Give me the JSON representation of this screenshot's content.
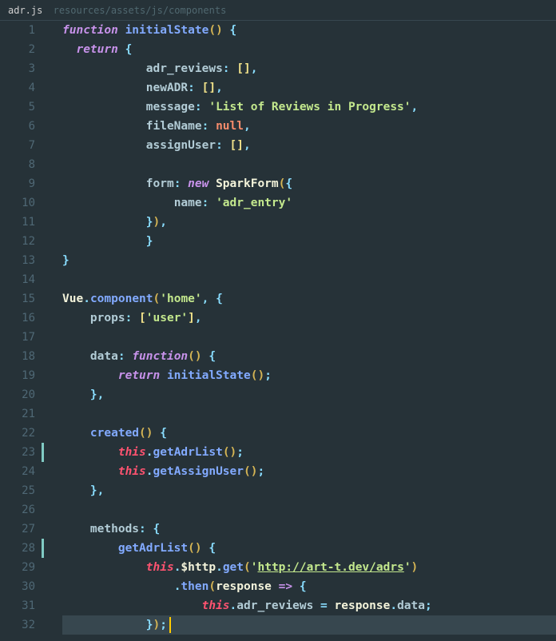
{
  "header": {
    "filename": "adr.js",
    "filepath": "resources/assets/js/components"
  },
  "lines": [
    {
      "num": 1,
      "marker": false,
      "hl": false,
      "tokens": [
        {
          "c": "kw",
          "t": "function "
        },
        {
          "c": "fn",
          "t": "initialState"
        },
        {
          "c": "paren",
          "t": "()"
        },
        {
          "c": "",
          "t": " "
        },
        {
          "c": "punct",
          "t": "{"
        }
      ]
    },
    {
      "num": 2,
      "marker": false,
      "hl": false,
      "tokens": [
        {
          "c": "",
          "t": "  "
        },
        {
          "c": "kw",
          "t": "return "
        },
        {
          "c": "punct",
          "t": "{"
        }
      ]
    },
    {
      "num": 3,
      "marker": false,
      "hl": false,
      "tokens": [
        {
          "c": "",
          "t": "            "
        },
        {
          "c": "prop",
          "t": "adr_reviews"
        },
        {
          "c": "punct",
          "t": ":"
        },
        {
          "c": "",
          "t": " "
        },
        {
          "c": "brack",
          "t": "[]"
        },
        {
          "c": "punct",
          "t": ","
        }
      ]
    },
    {
      "num": 4,
      "marker": false,
      "hl": false,
      "tokens": [
        {
          "c": "",
          "t": "            "
        },
        {
          "c": "prop",
          "t": "newADR"
        },
        {
          "c": "punct",
          "t": ":"
        },
        {
          "c": "",
          "t": " "
        },
        {
          "c": "brack",
          "t": "[]"
        },
        {
          "c": "punct",
          "t": ","
        }
      ]
    },
    {
      "num": 5,
      "marker": false,
      "hl": false,
      "tokens": [
        {
          "c": "",
          "t": "            "
        },
        {
          "c": "prop",
          "t": "message"
        },
        {
          "c": "punct",
          "t": ":"
        },
        {
          "c": "",
          "t": " "
        },
        {
          "c": "str",
          "t": "'List of Reviews in Progress'"
        },
        {
          "c": "punct",
          "t": ","
        }
      ]
    },
    {
      "num": 6,
      "marker": false,
      "hl": false,
      "tokens": [
        {
          "c": "",
          "t": "            "
        },
        {
          "c": "prop",
          "t": "fileName"
        },
        {
          "c": "punct",
          "t": ":"
        },
        {
          "c": "",
          "t": " "
        },
        {
          "c": "num-null",
          "t": "null"
        },
        {
          "c": "punct",
          "t": ","
        }
      ]
    },
    {
      "num": 7,
      "marker": false,
      "hl": false,
      "tokens": [
        {
          "c": "",
          "t": "            "
        },
        {
          "c": "prop",
          "t": "assignUser"
        },
        {
          "c": "punct",
          "t": ":"
        },
        {
          "c": "",
          "t": " "
        },
        {
          "c": "brack",
          "t": "[]"
        },
        {
          "c": "punct",
          "t": ","
        }
      ]
    },
    {
      "num": 8,
      "marker": false,
      "hl": false,
      "tokens": []
    },
    {
      "num": 9,
      "marker": false,
      "hl": false,
      "tokens": [
        {
          "c": "",
          "t": "            "
        },
        {
          "c": "prop",
          "t": "form"
        },
        {
          "c": "punct",
          "t": ":"
        },
        {
          "c": "",
          "t": " "
        },
        {
          "c": "kw",
          "t": "new "
        },
        {
          "c": "ident",
          "t": "SparkForm"
        },
        {
          "c": "paren",
          "t": "("
        },
        {
          "c": "punct",
          "t": "{"
        }
      ]
    },
    {
      "num": 10,
      "marker": false,
      "hl": false,
      "tokens": [
        {
          "c": "",
          "t": "                "
        },
        {
          "c": "prop",
          "t": "name"
        },
        {
          "c": "punct",
          "t": ":"
        },
        {
          "c": "",
          "t": " "
        },
        {
          "c": "str",
          "t": "'adr_entry'"
        }
      ]
    },
    {
      "num": 11,
      "marker": false,
      "hl": false,
      "tokens": [
        {
          "c": "",
          "t": "            "
        },
        {
          "c": "punct",
          "t": "}"
        },
        {
          "c": "paren",
          "t": ")"
        },
        {
          "c": "punct",
          "t": ","
        }
      ]
    },
    {
      "num": 12,
      "marker": false,
      "hl": false,
      "tokens": [
        {
          "c": "",
          "t": "            "
        },
        {
          "c": "punct",
          "t": "}"
        }
      ]
    },
    {
      "num": 13,
      "marker": false,
      "hl": false,
      "tokens": [
        {
          "c": "punct",
          "t": "}"
        }
      ]
    },
    {
      "num": 14,
      "marker": false,
      "hl": false,
      "tokens": []
    },
    {
      "num": 15,
      "marker": false,
      "hl": false,
      "tokens": [
        {
          "c": "ident",
          "t": "Vue"
        },
        {
          "c": "punct",
          "t": "."
        },
        {
          "c": "method",
          "t": "component"
        },
        {
          "c": "paren",
          "t": "("
        },
        {
          "c": "str",
          "t": "'home'"
        },
        {
          "c": "punct",
          "t": ","
        },
        {
          "c": "",
          "t": " "
        },
        {
          "c": "punct",
          "t": "{"
        }
      ]
    },
    {
      "num": 16,
      "marker": false,
      "hl": false,
      "tokens": [
        {
          "c": "",
          "t": "    "
        },
        {
          "c": "prop",
          "t": "props"
        },
        {
          "c": "punct",
          "t": ":"
        },
        {
          "c": "",
          "t": " "
        },
        {
          "c": "brack",
          "t": "["
        },
        {
          "c": "str",
          "t": "'user'"
        },
        {
          "c": "brack",
          "t": "]"
        },
        {
          "c": "punct",
          "t": ","
        }
      ]
    },
    {
      "num": 17,
      "marker": false,
      "hl": false,
      "tokens": []
    },
    {
      "num": 18,
      "marker": false,
      "hl": false,
      "tokens": [
        {
          "c": "",
          "t": "    "
        },
        {
          "c": "prop",
          "t": "data"
        },
        {
          "c": "punct",
          "t": ":"
        },
        {
          "c": "",
          "t": " "
        },
        {
          "c": "kw",
          "t": "function"
        },
        {
          "c": "paren",
          "t": "()"
        },
        {
          "c": "",
          "t": " "
        },
        {
          "c": "punct",
          "t": "{"
        }
      ]
    },
    {
      "num": 19,
      "marker": false,
      "hl": false,
      "tokens": [
        {
          "c": "",
          "t": "        "
        },
        {
          "c": "kw",
          "t": "return "
        },
        {
          "c": "method",
          "t": "initialState"
        },
        {
          "c": "paren",
          "t": "()"
        },
        {
          "c": "punct",
          "t": ";"
        }
      ]
    },
    {
      "num": 20,
      "marker": false,
      "hl": false,
      "tokens": [
        {
          "c": "",
          "t": "    "
        },
        {
          "c": "punct",
          "t": "},"
        }
      ]
    },
    {
      "num": 21,
      "marker": false,
      "hl": false,
      "tokens": []
    },
    {
      "num": 22,
      "marker": false,
      "hl": false,
      "tokens": [
        {
          "c": "",
          "t": "    "
        },
        {
          "c": "method",
          "t": "created"
        },
        {
          "c": "paren",
          "t": "()"
        },
        {
          "c": "",
          "t": " "
        },
        {
          "c": "punct",
          "t": "{"
        }
      ]
    },
    {
      "num": 23,
      "marker": true,
      "hl": false,
      "tokens": [
        {
          "c": "",
          "t": "        "
        },
        {
          "c": "this",
          "t": "this"
        },
        {
          "c": "punct",
          "t": "."
        },
        {
          "c": "method",
          "t": "getAdrList"
        },
        {
          "c": "paren",
          "t": "()"
        },
        {
          "c": "punct",
          "t": ";"
        }
      ]
    },
    {
      "num": 24,
      "marker": false,
      "hl": false,
      "tokens": [
        {
          "c": "",
          "t": "        "
        },
        {
          "c": "this",
          "t": "this"
        },
        {
          "c": "punct",
          "t": "."
        },
        {
          "c": "method",
          "t": "getAssignUser"
        },
        {
          "c": "paren",
          "t": "()"
        },
        {
          "c": "punct",
          "t": ";"
        }
      ]
    },
    {
      "num": 25,
      "marker": false,
      "hl": false,
      "tokens": [
        {
          "c": "",
          "t": "    "
        },
        {
          "c": "punct",
          "t": "},"
        }
      ]
    },
    {
      "num": 26,
      "marker": false,
      "hl": false,
      "tokens": []
    },
    {
      "num": 27,
      "marker": false,
      "hl": false,
      "tokens": [
        {
          "c": "",
          "t": "    "
        },
        {
          "c": "prop",
          "t": "methods"
        },
        {
          "c": "punct",
          "t": ":"
        },
        {
          "c": "",
          "t": " "
        },
        {
          "c": "punct",
          "t": "{"
        }
      ]
    },
    {
      "num": 28,
      "marker": true,
      "hl": false,
      "tokens": [
        {
          "c": "",
          "t": "        "
        },
        {
          "c": "method",
          "t": "getAdrList"
        },
        {
          "c": "paren",
          "t": "()"
        },
        {
          "c": "",
          "t": " "
        },
        {
          "c": "punct",
          "t": "{"
        }
      ]
    },
    {
      "num": 29,
      "marker": false,
      "hl": false,
      "tokens": [
        {
          "c": "",
          "t": "            "
        },
        {
          "c": "this",
          "t": "this"
        },
        {
          "c": "punct",
          "t": "."
        },
        {
          "c": "ident",
          "t": "$http"
        },
        {
          "c": "punct",
          "t": "."
        },
        {
          "c": "method",
          "t": "get"
        },
        {
          "c": "paren",
          "t": "("
        },
        {
          "c": "str",
          "t": "'"
        },
        {
          "c": "link",
          "t": "http://art-t.dev/adrs"
        },
        {
          "c": "str",
          "t": "'"
        },
        {
          "c": "paren",
          "t": ")"
        }
      ]
    },
    {
      "num": 30,
      "marker": false,
      "hl": false,
      "tokens": [
        {
          "c": "",
          "t": "                "
        },
        {
          "c": "punct",
          "t": "."
        },
        {
          "c": "method",
          "t": "then"
        },
        {
          "c": "paren",
          "t": "("
        },
        {
          "c": "ident",
          "t": "response"
        },
        {
          "c": "",
          "t": " "
        },
        {
          "c": "kw",
          "t": "=>"
        },
        {
          "c": "",
          "t": " "
        },
        {
          "c": "punct",
          "t": "{"
        }
      ]
    },
    {
      "num": 31,
      "marker": false,
      "hl": false,
      "tokens": [
        {
          "c": "",
          "t": "                    "
        },
        {
          "c": "this",
          "t": "this"
        },
        {
          "c": "punct",
          "t": "."
        },
        {
          "c": "prop",
          "t": "adr_reviews"
        },
        {
          "c": "",
          "t": " "
        },
        {
          "c": "punct",
          "t": "="
        },
        {
          "c": "",
          "t": " "
        },
        {
          "c": "ident",
          "t": "response"
        },
        {
          "c": "punct",
          "t": "."
        },
        {
          "c": "prop",
          "t": "data"
        },
        {
          "c": "punct",
          "t": ";"
        }
      ]
    },
    {
      "num": 32,
      "marker": false,
      "hl": true,
      "cursor": true,
      "tokens": [
        {
          "c": "",
          "t": "            "
        },
        {
          "c": "punct",
          "t": "}"
        },
        {
          "c": "paren",
          "t": ")"
        },
        {
          "c": "punct",
          "t": ";"
        }
      ]
    }
  ]
}
